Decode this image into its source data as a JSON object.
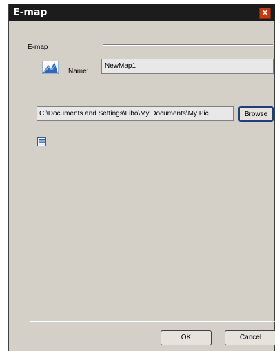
{
  "window": {
    "title": "E-map",
    "close_glyph": "×"
  },
  "emap_group": {
    "label": "E-map",
    "icon": "map-icon",
    "name_label": "Name:",
    "name_value": "NewMap1"
  },
  "file": {
    "path_value": "C:\\Documents and Settings\\Libo\\My Documents\\My Pic",
    "browse_label": "Browse",
    "icon": "document-list-icon"
  },
  "footer": {
    "ok_label": "OK",
    "cancel_label": "Cancel"
  },
  "colors": {
    "titlebar": "#1c1c1c",
    "dialog_bg": "#d4d0c8",
    "close_button": "#c63b16",
    "field_bg": "#e8e8e8",
    "focus_border": "#1f3f7a"
  }
}
